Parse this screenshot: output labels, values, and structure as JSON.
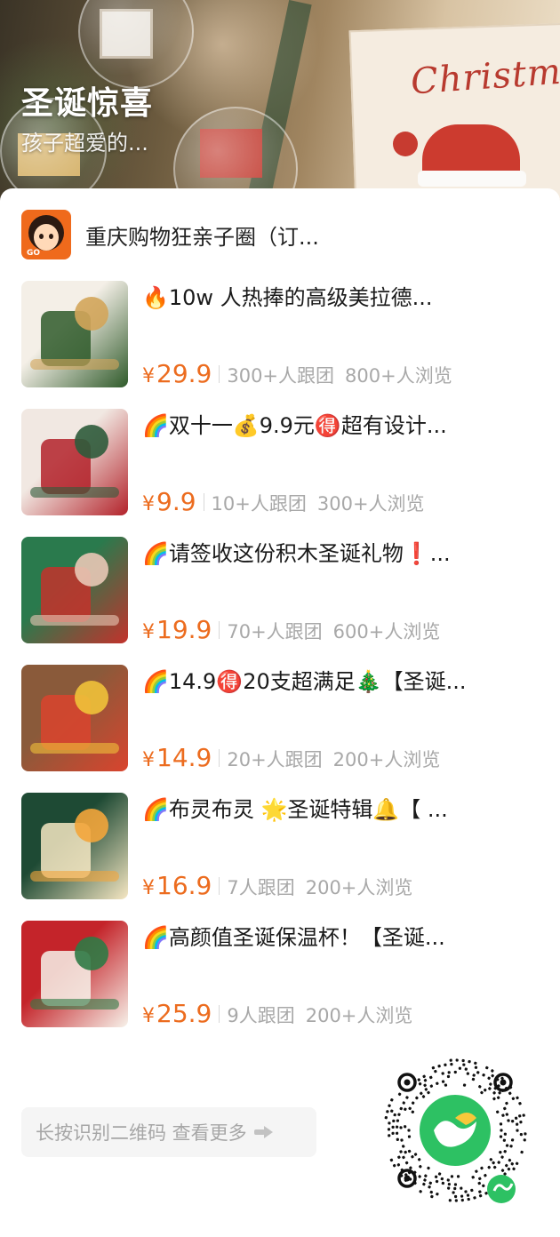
{
  "banner": {
    "title": "圣诞惊喜",
    "subtitle": "孩子超爱的...",
    "box_word": "Christmas"
  },
  "shop": {
    "name": "重庆购物狂亲子圈（订...",
    "logo_text": "GO"
  },
  "products": [
    {
      "title": "🔥10w 人热捧的高级美拉德...",
      "price": "29.9",
      "currency": "¥",
      "followers": "300+人跟团",
      "views": "800+人浏览",
      "thumb_colors": [
        "#f4efe7",
        "#2f5a2a",
        "#d3a55a"
      ]
    },
    {
      "title": "🌈双十一💰9.9元🉐超有设计...",
      "price": "9.9",
      "currency": "¥",
      "followers": "10+人跟团",
      "views": "300+人浏览",
      "thumb_colors": [
        "#f1e8e2",
        "#b3222a",
        "#2e5b3b"
      ]
    },
    {
      "title": "🌈请签收这份积木圣诞礼物❗...",
      "price": "19.9",
      "currency": "¥",
      "followers": "70+人跟团",
      "views": "600+人浏览",
      "thumb_colors": [
        "#2a7a4d",
        "#c3322c",
        "#e9c8b6"
      ]
    },
    {
      "title": "🌈14.9🉐20支超满足🎄【圣诞...",
      "price": "14.9",
      "currency": "¥",
      "followers": "20+人跟团",
      "views": "200+人浏览",
      "thumb_colors": [
        "#8a5a3a",
        "#d9442e",
        "#f0c23a"
      ]
    },
    {
      "title": "🌈布灵布灵 🌟圣诞特辑🔔【 ...",
      "price": "16.9",
      "currency": "¥",
      "followers": "7人跟团",
      "views": "200+人浏览",
      "thumb_colors": [
        "#1e4a34",
        "#f6e7c3",
        "#f3a53b"
      ]
    },
    {
      "title": "🌈高颜值圣诞保温杯！【圣诞...",
      "price": "25.9",
      "currency": "¥",
      "followers": "9人跟团",
      "views": "200+人浏览",
      "thumb_colors": [
        "#c4242a",
        "#f7f2ea",
        "#2f7a45"
      ]
    }
  ],
  "footer": {
    "hint": "长按识别二维码 查看更多",
    "qr_icon": "mini-program-qr-icon",
    "accent": "#2dc163"
  },
  "colors": {
    "price": "#ec6c1f",
    "meta": "#a8a8a8",
    "title": "#1a1a1a"
  }
}
